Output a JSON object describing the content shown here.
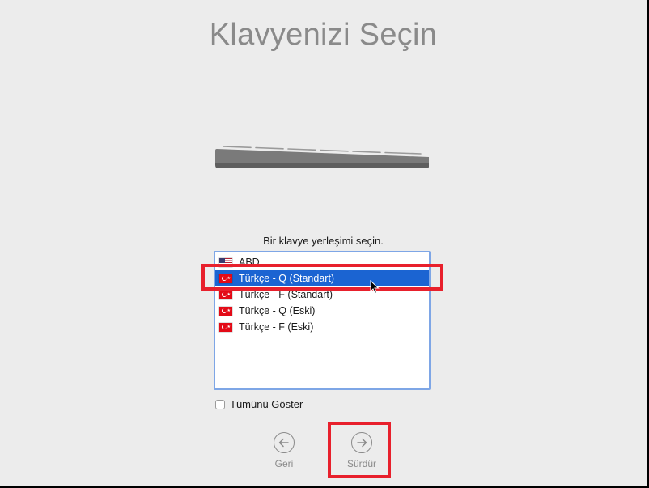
{
  "page": {
    "title": "Klavyenizi Seçin",
    "prompt": "Bir klavye yerleşimi seçin."
  },
  "keyboard_list": {
    "items": [
      {
        "label": "ABD",
        "flag": "us-flag-icon"
      },
      {
        "label": "Türkçe - Q (Standart)",
        "flag": "turkey-flag-icon",
        "selected": true
      },
      {
        "label": "Türkçe - F (Standart)",
        "flag": "turkey-flag-icon"
      },
      {
        "label": "Türkçe - Q (Eski)",
        "flag": "turkey-flag-icon"
      },
      {
        "label": "Türkçe - F (Eski)",
        "flag": "turkey-flag-icon"
      }
    ]
  },
  "show_all": {
    "label": "Tümünü Göster",
    "checked": false
  },
  "navigation": {
    "back_label": "Geri",
    "continue_label": "Sürdür"
  },
  "colors": {
    "selection": "#1b64d2",
    "highlight": "#e8202c",
    "title": "#8a8a8a"
  }
}
